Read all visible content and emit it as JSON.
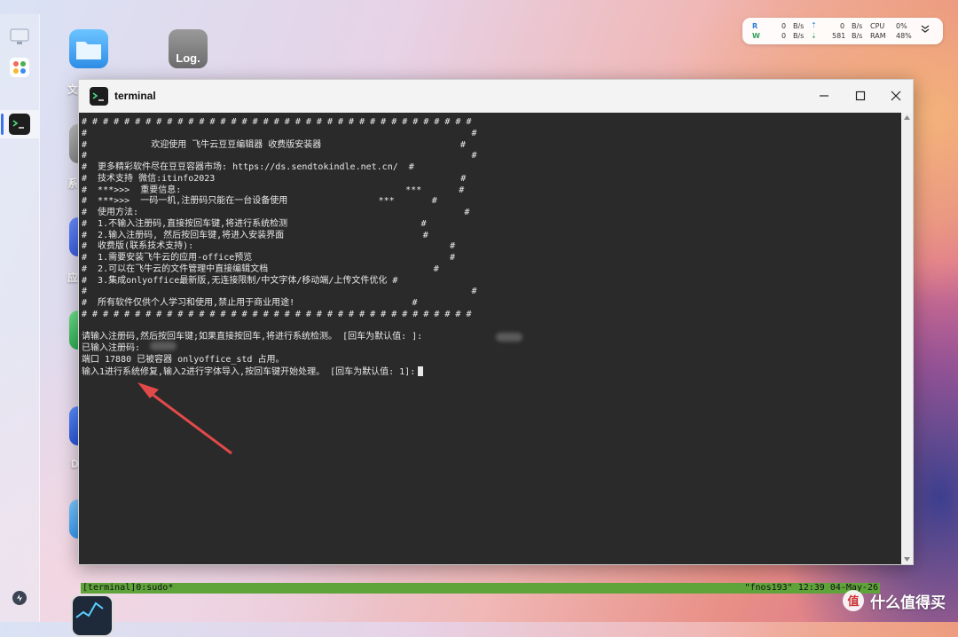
{
  "desktop": {
    "labels": [
      "文",
      "系",
      "应",
      "D"
    ],
    "log_icon_label": "Log."
  },
  "system_widget": {
    "r_label": "R",
    "w_label": "W",
    "r_value": "0",
    "w_value": "0",
    "r_unit": "B/s",
    "w_unit": "B/s",
    "r2_value": "0",
    "w2_value": "581",
    "r2_unit": "B/s",
    "w2_unit": "B/s",
    "cpu_label": "CPU",
    "ram_label": "RAM",
    "cpu_value": "0%",
    "ram_value": "48%",
    "up_color": "#2e7ed8",
    "down_color": "#2e9f5a"
  },
  "window": {
    "title": "terminal",
    "icon_glyph": ">_"
  },
  "terminal": {
    "lines": [
      "# # # # # # # # # # # # # # # # # # # # # # # # # # # # # # # # # # # # #",
      "#                                                                        #",
      "#            欢迎使用 飞牛云豆豆编辑器 收费版安装器                          #",
      "#                                                                        #",
      "#  更多精彩软件尽在豆豆容器市场: https://ds.sendtokindle.net.cn/  #",
      "#  技术支持 微信:itinfo2023                                              #",
      "#  ***>>>  重要信息:                                          ***       #",
      "#  ***>>>  一码一机,注册码只能在一台设备使用                 ***       #",
      "#  使用方法:                                                             #",
      "#  1.不输入注册码,直接按回车键,将进行系统检测                         #",
      "#  2.输入注册码, 然后按回车键,将进入安装界面                          #",
      "#  收费版(联系技术支持):                                                #",
      "#  1.需要安装飞牛云的应用-office预览                                     #",
      "#  2.可以在飞牛云的文件管理中直接编辑文档                               #",
      "#  3.集成onlyoffice最新版,无连接限制/中文字体/移动端/上传文件优化 #",
      "#                                                                        #",
      "#  所有软件仅供个人学习和使用,禁止用于商业用途!                      #",
      "# # # # # # # # # # # # # # # # # # # # # # # # # # # # # # # # # # # # #",
      "",
      "请输入注册码,然后按回车键;如果直接按回车,将进行系统检测。 [回车为默认值: ]:",
      "已输入注册码:",
      "端口 17880 已被容器 onlyoffice_std 占用。",
      "输入1进行系统修复,输入2进行字体导入,按回车键开始处理。 [回车为默认值: 1]:"
    ],
    "status_left": "[terminal]0:sudo*",
    "status_right": "\"fnos193\" 12:39 04-May-26",
    "status_color": "#5fa43a",
    "arrow_color": "#e24a4a"
  },
  "watermark": {
    "text": "什么值得买",
    "badge": "值"
  }
}
